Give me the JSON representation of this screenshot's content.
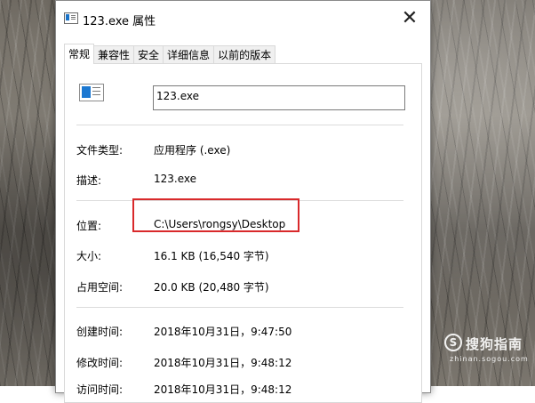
{
  "window": {
    "title": "123.exe 属性",
    "close_glyph": "✕"
  },
  "tabs": [
    {
      "label": "常规",
      "active": true
    },
    {
      "label": "兼容性",
      "active": false
    },
    {
      "label": "安全",
      "active": false
    },
    {
      "label": "详细信息",
      "active": false
    },
    {
      "label": "以前的版本",
      "active": false
    }
  ],
  "general": {
    "file_name": "123.exe",
    "file_type_label": "文件类型:",
    "file_type_value": "应用程序 (.exe)",
    "description_label": "描述:",
    "description_value": "123.exe",
    "location_label": "位置:",
    "location_value": "C:\\Users\\rongsy\\Desktop",
    "size_label": "大小:",
    "size_value": "16.1 KB (16,540 字节)",
    "size_on_disk_label": "占用空间:",
    "size_on_disk_value": "20.0 KB (20,480 字节)",
    "created_label": "创建时间:",
    "created_value": "2018年10月31日，9:47:50",
    "modified_label": "修改时间:",
    "modified_value": "2018年10月31日，9:48:12",
    "accessed_label": "访问时间:",
    "accessed_value": "2018年10月31日，9:48:12"
  },
  "annotation": {
    "highlight_color": "#d9292b"
  },
  "watermark": {
    "logo_glyph": "S",
    "text": "搜狗指南",
    "subtext": "zhinan.sogou.com"
  }
}
